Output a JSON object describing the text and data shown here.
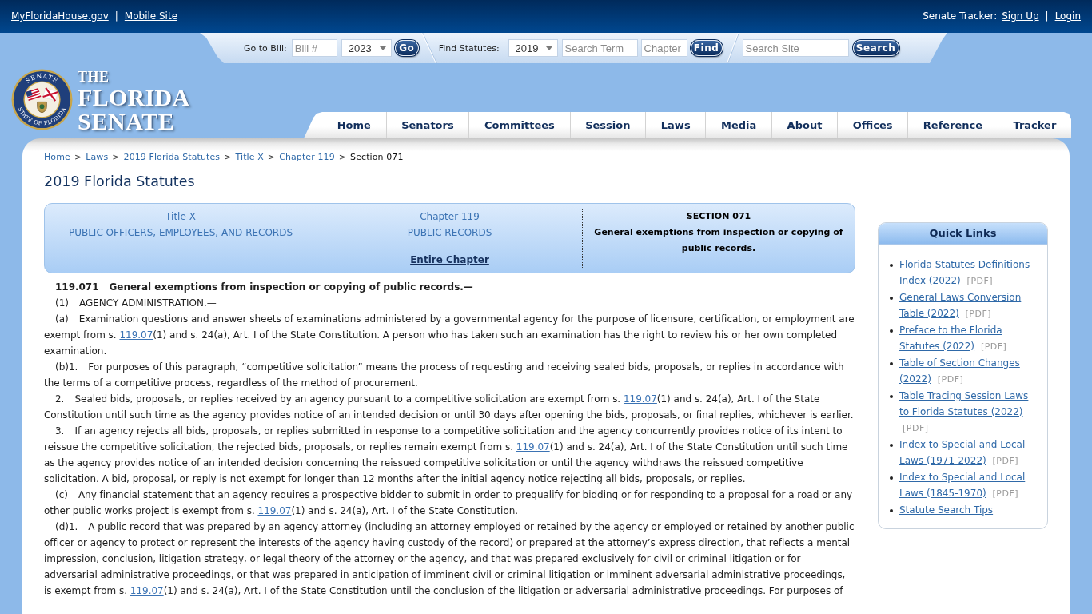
{
  "top_bar": {
    "left": [
      {
        "kind": "link",
        "text": "MyFloridaHouse.gov"
      },
      {
        "kind": "separator",
        "text": "|"
      },
      {
        "kind": "link",
        "text": "Mobile Site"
      }
    ],
    "right": [
      {
        "kind": "label",
        "text": "Senate Tracker:"
      },
      {
        "kind": "link",
        "text": "Sign Up"
      },
      {
        "kind": "separator",
        "text": "|"
      },
      {
        "kind": "link",
        "text": "Login"
      }
    ]
  },
  "search_bar": {
    "bill": {
      "label": "Go to Bill:",
      "placeholder": "Bill #",
      "year": "2023",
      "button": "Go"
    },
    "statutes": {
      "label": "Find Statutes:",
      "year": "2019",
      "term_placeholder": "Search Term",
      "chapter_placeholder": "Chapter",
      "button": "Find"
    },
    "site": {
      "placeholder": "Search Site",
      "button": "Search"
    }
  },
  "logo": {
    "seal_top": "SENATE",
    "seal_bottom": "STATE OF FLORIDA",
    "wordmark": [
      "THE",
      "FLORIDA",
      "SENATE"
    ]
  },
  "nav": [
    "Home",
    "Senators",
    "Committees",
    "Session",
    "Laws",
    "Media",
    "About",
    "Offices",
    "Reference",
    "Tracker"
  ],
  "breadcrumb": [
    {
      "kind": "link",
      "text": "Home"
    },
    {
      "kind": "separator",
      "text": ">"
    },
    {
      "kind": "link",
      "text": "Laws"
    },
    {
      "kind": "separator",
      "text": ">"
    },
    {
      "kind": "link",
      "text": "2019 Florida Statutes"
    },
    {
      "kind": "separator",
      "text": ">"
    },
    {
      "kind": "link",
      "text": "Title X"
    },
    {
      "kind": "separator",
      "text": ">"
    },
    {
      "kind": "link",
      "text": "Chapter 119"
    },
    {
      "kind": "separator",
      "text": ">"
    },
    {
      "kind": "current",
      "text": "Section 071"
    }
  ],
  "page_title": "2019 Florida Statutes",
  "section_box": {
    "title": {
      "link": "Title X",
      "name": "PUBLIC OFFICERS, EMPLOYEES, AND RECORDS"
    },
    "chapter": {
      "link": "Chapter 119",
      "name": "PUBLIC RECORDS",
      "entire": "Entire Chapter"
    },
    "section": {
      "heading": "SECTION 071",
      "name": "General exemptions from inspection or copying of public records."
    }
  },
  "statute": {
    "number": "119.071",
    "title": "General exemptions from inspection or copying of public records.—",
    "paragraphs": [
      {
        "number": "(1)",
        "segments": [
          {
            "kind": "text",
            "text": "AGENCY ADMINISTRATION.—"
          }
        ]
      },
      {
        "number": "(a)",
        "segments": [
          {
            "kind": "text",
            "text": "Examination questions and answer sheets of examinations administered by a governmental agency for the purpose of licensure, certification, or employment are exempt from s. "
          },
          {
            "kind": "link",
            "text": "119.07"
          },
          {
            "kind": "text",
            "text": "(1) and s. 24(a), Art. I of the State Constitution. A person who has taken such an examination has the right to review his or her own completed examination."
          }
        ]
      },
      {
        "number": "(b)1.",
        "segments": [
          {
            "kind": "text",
            "text": "For purposes of this paragraph, “competitive solicitation” means the process of requesting and receiving sealed bids, proposals, or replies in accordance with the terms of a competitive process, regardless of the method of procurement."
          }
        ]
      },
      {
        "number": "2.",
        "segments": [
          {
            "kind": "text",
            "text": "Sealed bids, proposals, or replies received by an agency pursuant to a competitive solicitation are exempt from s. "
          },
          {
            "kind": "link",
            "text": "119.07"
          },
          {
            "kind": "text",
            "text": "(1) and s. 24(a), Art. I of the State Constitution until such time as the agency provides notice of an intended decision or until 30 days after opening the bids, proposals, or final replies, whichever is earlier."
          }
        ]
      },
      {
        "number": "3.",
        "segments": [
          {
            "kind": "text",
            "text": "If an agency rejects all bids, proposals, or replies submitted in response to a competitive solicitation and the agency concurrently provides notice of its intent to reissue the competitive solicitation, the rejected bids, proposals, or replies remain exempt from s. "
          },
          {
            "kind": "link",
            "text": "119.07"
          },
          {
            "kind": "text",
            "text": "(1) and s. 24(a), Art. I of the State Constitution until such time as the agency provides notice of an intended decision concerning the reissued competitive solicitation or until the agency withdraws the reissued competitive solicitation. A bid, proposal, or reply is not exempt for longer than 12 months after the initial agency notice rejecting all bids, proposals, or replies."
          }
        ]
      },
      {
        "number": "(c)",
        "segments": [
          {
            "kind": "text",
            "text": "Any financial statement that an agency requires a prospective bidder to submit in order to prequalify for bidding or for responding to a proposal for a road or any other public works project is exempt from s. "
          },
          {
            "kind": "link",
            "text": "119.07"
          },
          {
            "kind": "text",
            "text": "(1) and s. 24(a), Art. I of the State Constitution."
          }
        ]
      },
      {
        "number": "(d)1.",
        "segments": [
          {
            "kind": "text",
            "text": "A public record that was prepared by an agency attorney (including an attorney employed or retained by the agency or employed or retained by another public officer or agency to protect or represent the interests of the agency having custody of the record) or prepared at the attorney’s express direction, that reflects a mental impression, conclusion, litigation strategy, or legal theory of the attorney or the agency, and that was prepared exclusively for civil or criminal litigation or for adversarial administrative proceedings, or that was prepared in anticipation of imminent civil or criminal litigation or imminent adversarial administrative proceedings, is exempt from s. "
          },
          {
            "kind": "link",
            "text": "119.07"
          },
          {
            "kind": "text",
            "text": "(1) and s. 24(a), Art. I of the State Constitution until the conclusion of the litigation or adversarial administrative proceedings. For purposes of"
          }
        ]
      }
    ]
  },
  "quick_links": {
    "title": "Quick Links",
    "items": [
      {
        "label": "Florida Statutes Definitions Index (2022)",
        "tag": "[PDF]"
      },
      {
        "label": "General Laws Conversion Table (2022)",
        "tag": "[PDF]"
      },
      {
        "label": "Preface to the Florida Statutes (2022)",
        "tag": "[PDF]"
      },
      {
        "label": "Table of Section Changes (2022)",
        "tag": "[PDF]"
      },
      {
        "label": "Table Tracing Session Laws to Florida Statutes (2022)",
        "tag": "[PDF]"
      },
      {
        "label": "Index to Special and Local Laws (1971-2022)",
        "tag": "[PDF]"
      },
      {
        "label": "Index to Special and Local Laws (1845-1970)",
        "tag": "[PDF]"
      },
      {
        "label": "Statute Search Tips"
      }
    ]
  }
}
